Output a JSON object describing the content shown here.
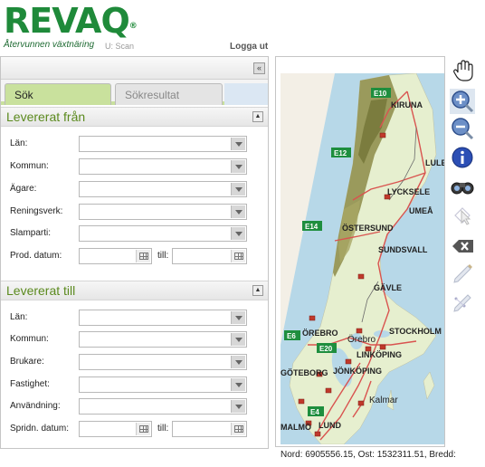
{
  "header": {
    "logo_text": "REVAQ",
    "tagline": "Återvunnen växtnäring",
    "user": "U: Scan",
    "logout": "Logga ut"
  },
  "tabs": {
    "search": "Sök",
    "results": "Sökresultat"
  },
  "from": {
    "title": "Levererat från",
    "lan": "Län:",
    "kommun": "Kommun:",
    "agare": "Ägare:",
    "reningsverk": "Reningsverk:",
    "slamparti": "Slamparti:",
    "date": "Prod. datum:",
    "till": "till:"
  },
  "to": {
    "title": "Levererat till",
    "lan": "Län:",
    "kommun": "Kommun:",
    "brukare": "Brukare:",
    "fastighet": "Fastighet:",
    "anvandning": "Användning:",
    "date": "Spridn. datum:",
    "till": "till:"
  },
  "map": {
    "roads": [
      "E10",
      "E12",
      "E14",
      "E6",
      "E20",
      "E4"
    ],
    "cities": [
      "KIRUNA",
      "LULEÅ",
      "LYCKSELE",
      "UMEÅ",
      "ÖSTERSUND",
      "SUNDSVALL",
      "GÄVLE",
      "ÖREBRO",
      "Örebro",
      "STOCKHOLM",
      "LINKÖPING",
      "JÖNKÖPING",
      "GÖTEBORG",
      "Kalmar",
      "MALMÖ",
      "LUND"
    ]
  },
  "toolbar": [
    "hand-icon",
    "zoom-in-icon",
    "zoom-out-icon",
    "info-icon",
    "binoculars-icon",
    "select-icon",
    "delete-icon",
    "draw-icon",
    "measure-icon"
  ],
  "status": "Nord: 6905556.15, Ost: 1532311.51, Bredd:"
}
